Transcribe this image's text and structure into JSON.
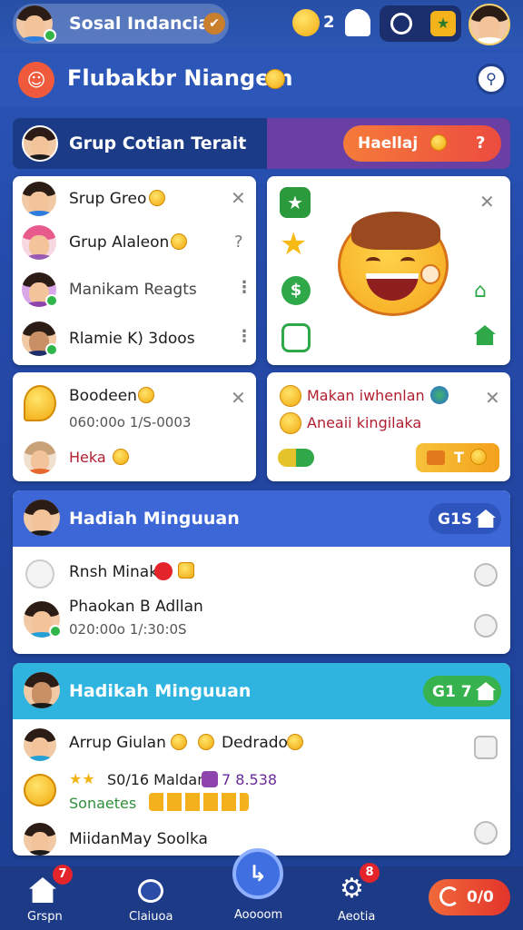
{
  "topbar": {
    "username": "Sosal Indancia",
    "score": "2"
  },
  "titlebar": {
    "title": "Flubakbr Niangem"
  },
  "group_banner": {
    "title": "Grup Cotian Terait",
    "action_label": "Haellaj",
    "action_suffix": "?"
  },
  "group_list": {
    "items": [
      {
        "label": "Srup Greo"
      },
      {
        "label": "Grup Alaleon"
      },
      {
        "label": "Manikam Reagts"
      },
      {
        "label": "Rlamie K) 3doos"
      }
    ],
    "side_glyph": "?"
  },
  "notice_card": {
    "title": "Boodeen",
    "subtitle": "060:00o 1/S-0003",
    "tag": "Heka"
  },
  "promo_card": {
    "line1": "Makan iwhenlan",
    "line2": "Aneaii kingilaka",
    "button_label": "T"
  },
  "weekly1": {
    "title": "Hadiah Minguuan",
    "badge": "G1S",
    "rows": [
      {
        "label": "Rnsh Minak"
      },
      {
        "label": "Phaokan B Adllan",
        "sub": "020:00o 1/:30:0S"
      }
    ]
  },
  "weekly2": {
    "title": "Hadikah Minguuan",
    "badge": "G1 7",
    "rows": [
      {
        "label": "Arrup Giulan",
        "extra": "Dedrado"
      },
      {
        "label": "S0/16 Maldan",
        "value": "7 8.538",
        "sub": "Sonaetes"
      },
      {
        "label": "MiidanMay Soolka"
      }
    ]
  },
  "bottomnav": {
    "items": [
      {
        "label": "Grspn",
        "badge": "7"
      },
      {
        "label": "Claiuoa"
      },
      {
        "label": "Aoooom"
      },
      {
        "label": "Aeotia",
        "badge": "8"
      }
    ],
    "pill_label": "0/0"
  },
  "colors": {
    "accent_blue": "#3f6fe0",
    "accent_orange": "#f3573a",
    "accent_green": "#2fb54a",
    "teal_band": "#2fb4e0",
    "purple": "#6a3fa3"
  }
}
